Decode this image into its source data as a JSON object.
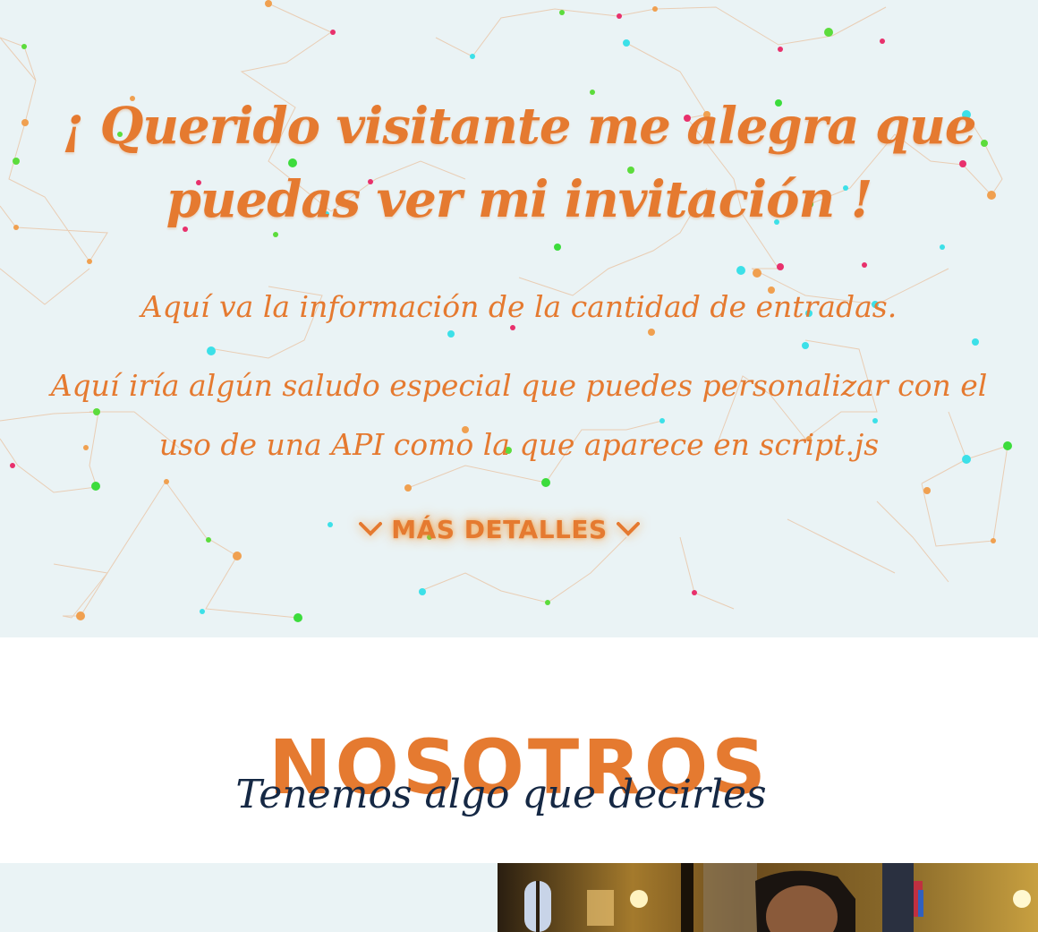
{
  "hero": {
    "title": "¡ Querido visitante me alegra que puedas ver mi invitación !",
    "tickets_info": "Aquí va la información de la cantidad de entradas.",
    "greeting": "Aquí iría algún saludo especial que puedes personalizar con el uso de una API como la que aparece en script.js",
    "more_details": "MÁS DETALLES",
    "accent_color": "#e57a30",
    "background_color": "#eaf3f5"
  },
  "about": {
    "title": "NOSOTROS",
    "subtitle": "Tenemos algo que decirles",
    "subtitle_color": "#152844"
  },
  "icons": [
    "chevron-down-icon",
    "chevron-down-icon"
  ]
}
